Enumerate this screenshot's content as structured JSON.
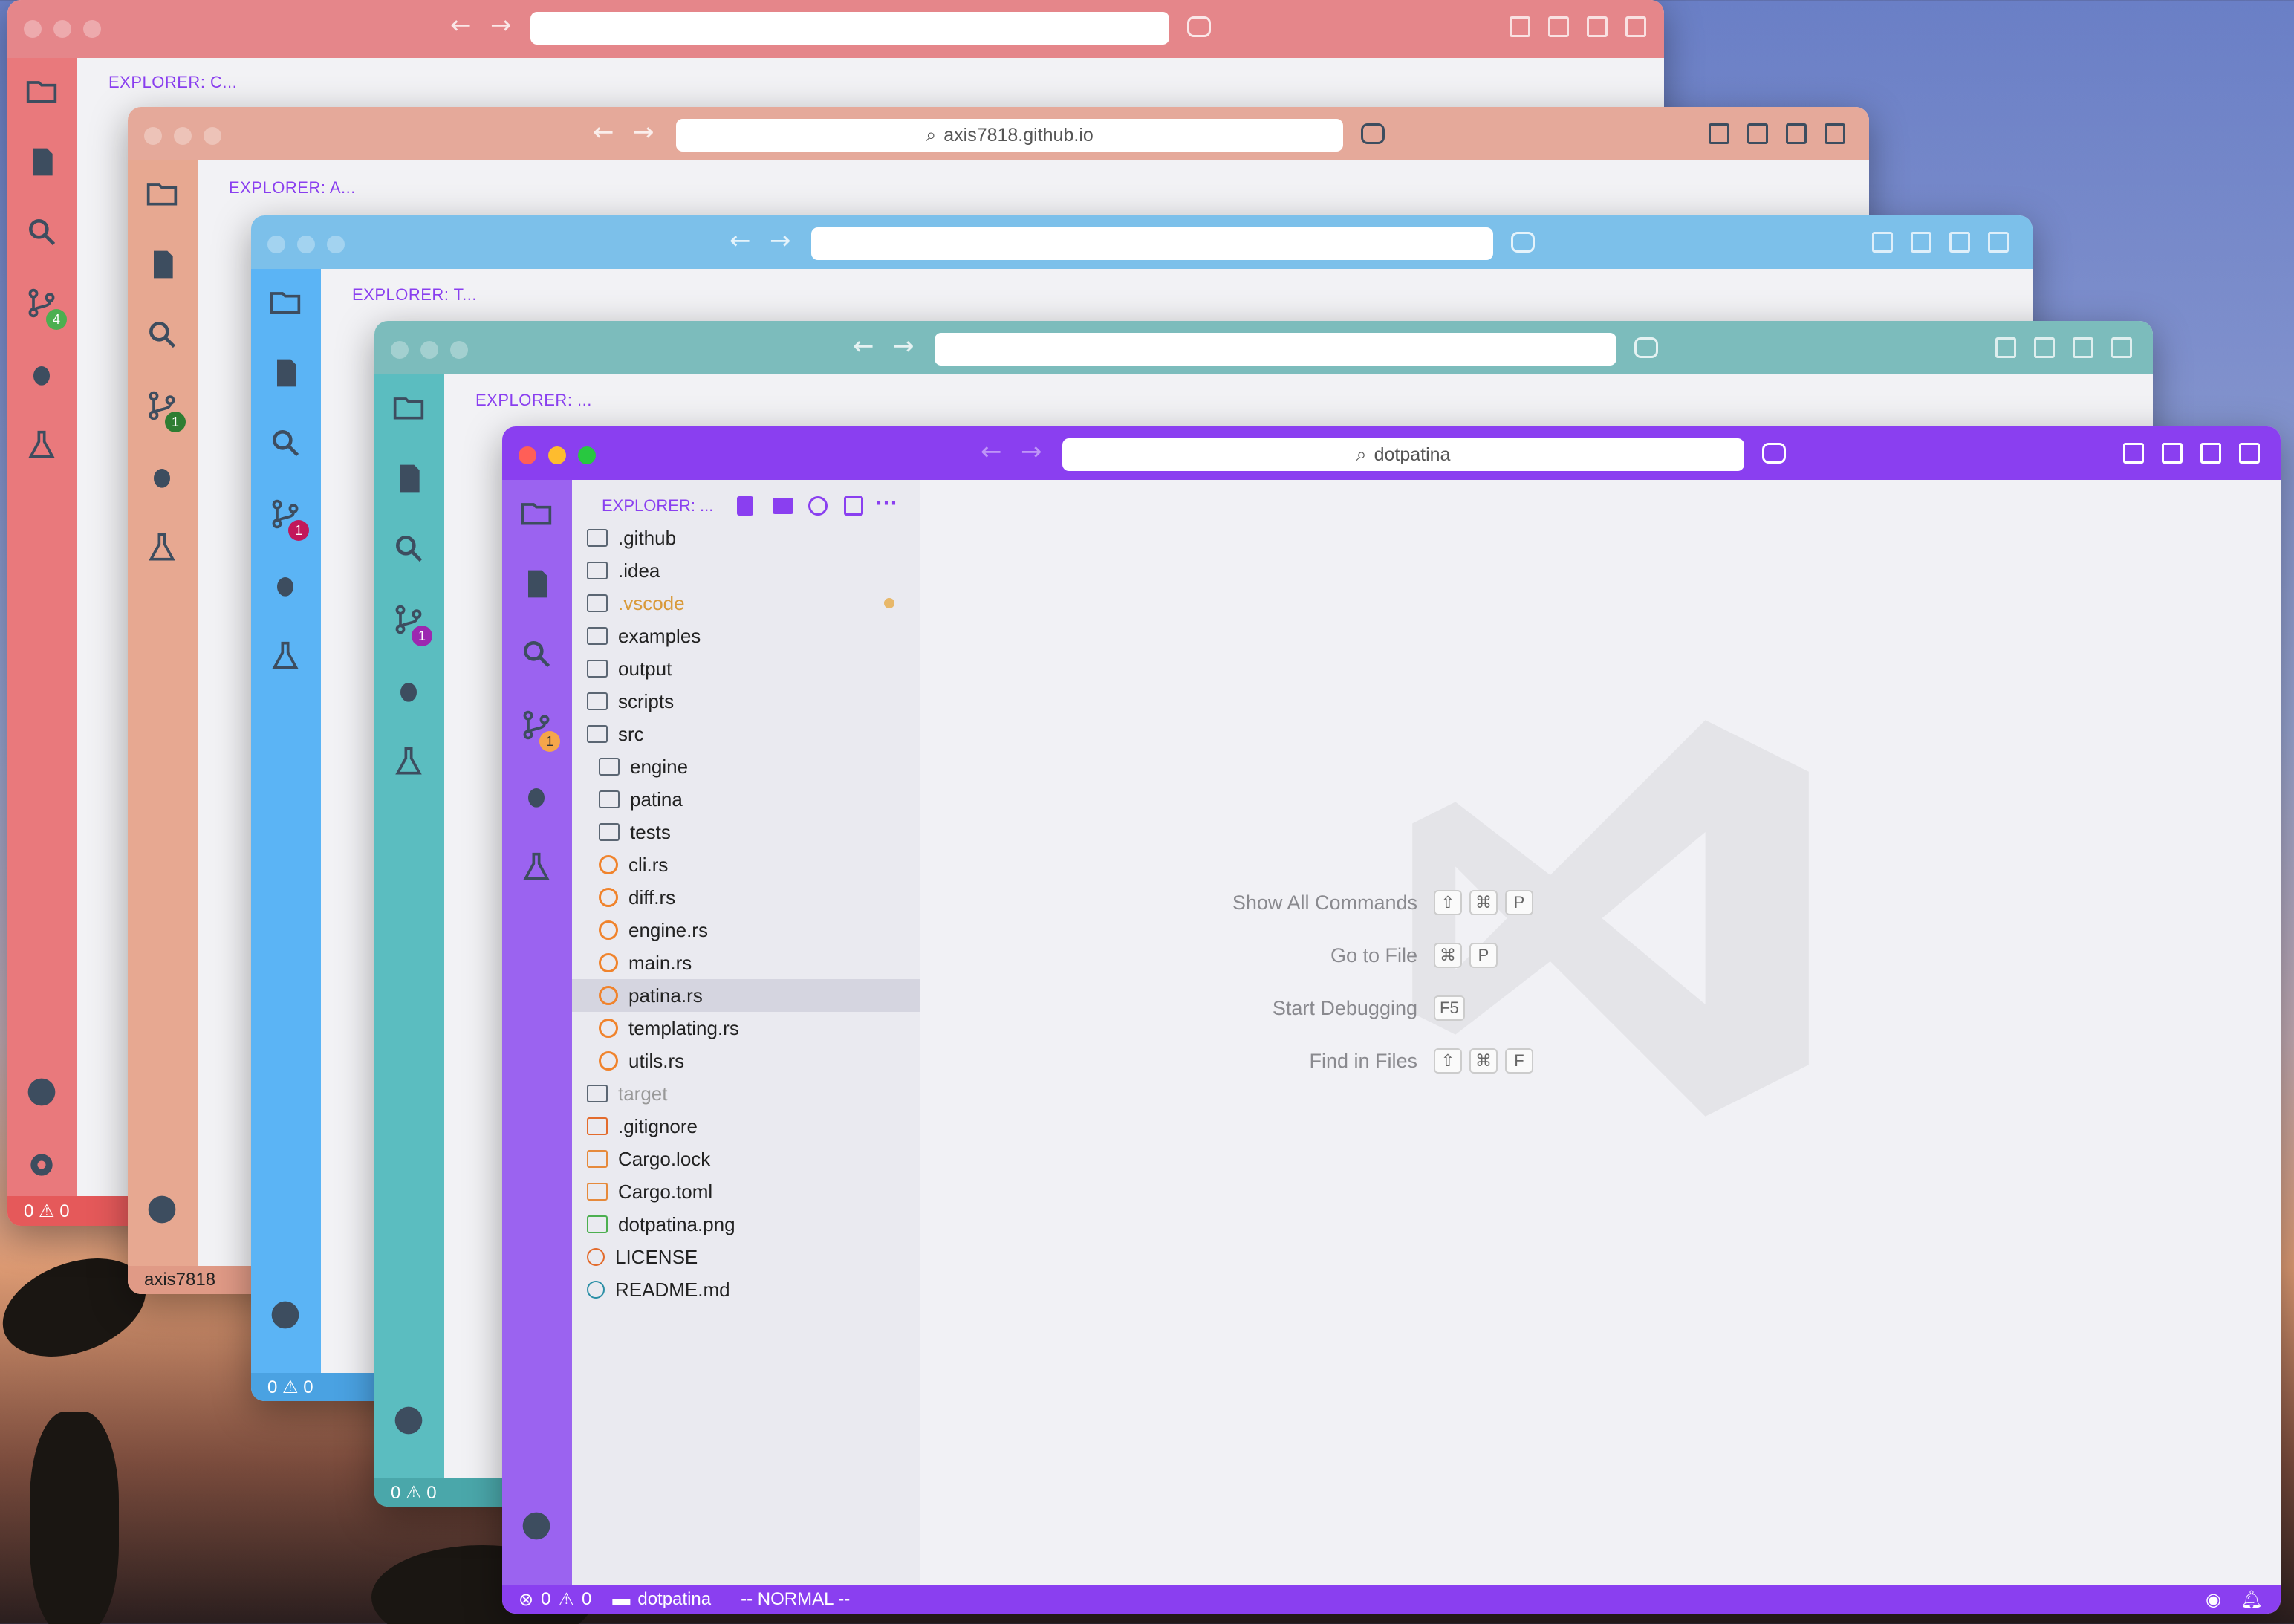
{
  "windows": {
    "w1": {
      "explorer": "EXPLORER: C...",
      "status": "0 ⚠ 0",
      "accent": "#e5868a",
      "activity": "#e9797c",
      "badge": "4"
    },
    "w2": {
      "address": "axis7818.github.io",
      "explorer": "EXPLORER: A...",
      "status": "axis7818",
      "accent": "#e5a99a",
      "activity": "#e7a891",
      "badge": "1"
    },
    "w3": {
      "explorer": "EXPLORER: T...",
      "status": "0 ⚠ 0",
      "accent": "#7cc0ea",
      "activity": "#5bb4f5",
      "badge": "1"
    },
    "w4": {
      "explorer": "EXPLORER: ...",
      "status": "0 ⚠ 0",
      "accent": "#7cbcbc",
      "activity": "#5bbdc0",
      "badge": "1"
    }
  },
  "front": {
    "address": "dotpatina",
    "explorer": "EXPLORER: ...",
    "badge": "1",
    "accent": "#8a3ff0",
    "tree": [
      {
        "label": ".github",
        "indent": 0,
        "kind": "folder"
      },
      {
        "label": ".idea",
        "indent": 0,
        "kind": "folder"
      },
      {
        "label": ".vscode",
        "indent": 0,
        "kind": "folder",
        "modified": true
      },
      {
        "label": "examples",
        "indent": 0,
        "kind": "folder"
      },
      {
        "label": "output",
        "indent": 0,
        "kind": "folder"
      },
      {
        "label": "scripts",
        "indent": 0,
        "kind": "folder"
      },
      {
        "label": "src",
        "indent": 0,
        "kind": "folder"
      },
      {
        "label": "engine",
        "indent": 1,
        "kind": "folder"
      },
      {
        "label": "patina",
        "indent": 1,
        "kind": "folder"
      },
      {
        "label": "tests",
        "indent": 1,
        "kind": "folder"
      },
      {
        "label": "cli.rs",
        "indent": 1,
        "kind": "rust"
      },
      {
        "label": "diff.rs",
        "indent": 1,
        "kind": "rust"
      },
      {
        "label": "engine.rs",
        "indent": 1,
        "kind": "rust"
      },
      {
        "label": "main.rs",
        "indent": 1,
        "kind": "rust"
      },
      {
        "label": "patina.rs",
        "indent": 1,
        "kind": "rust",
        "selected": true
      },
      {
        "label": "templating.rs",
        "indent": 1,
        "kind": "rust"
      },
      {
        "label": "utils.rs",
        "indent": 1,
        "kind": "rust"
      },
      {
        "label": "target",
        "indent": 0,
        "kind": "folder",
        "ignored": true
      },
      {
        "label": ".gitignore",
        "indent": 0,
        "kind": "git"
      },
      {
        "label": "Cargo.lock",
        "indent": 0,
        "kind": "cargo"
      },
      {
        "label": "Cargo.toml",
        "indent": 0,
        "kind": "cargo"
      },
      {
        "label": "dotpatina.png",
        "indent": 0,
        "kind": "image"
      },
      {
        "label": "LICENSE",
        "indent": 0,
        "kind": "license"
      },
      {
        "label": "README.md",
        "indent": 0,
        "kind": "info"
      }
    ],
    "commands": [
      {
        "label": "Show All Commands",
        "keys": [
          "⇧",
          "⌘",
          "P"
        ]
      },
      {
        "label": "Go to File",
        "keys": [
          "⌘",
          "P"
        ]
      },
      {
        "label": "Start Debugging",
        "keys": [
          "F5"
        ]
      },
      {
        "label": "Find in Files",
        "keys": [
          "⇧",
          "⌘",
          "F"
        ]
      }
    ],
    "status": {
      "errors": "0",
      "warnings": "0",
      "folder": "dotpatina",
      "mode": "-- NORMAL --"
    }
  },
  "icons": [
    "folder-icon",
    "files-icon",
    "search-icon",
    "source-control-icon",
    "debug-icon",
    "testing-icon",
    "account-icon",
    "settings-icon",
    "copilot-icon",
    "layout-icon",
    "bell-icon"
  ]
}
